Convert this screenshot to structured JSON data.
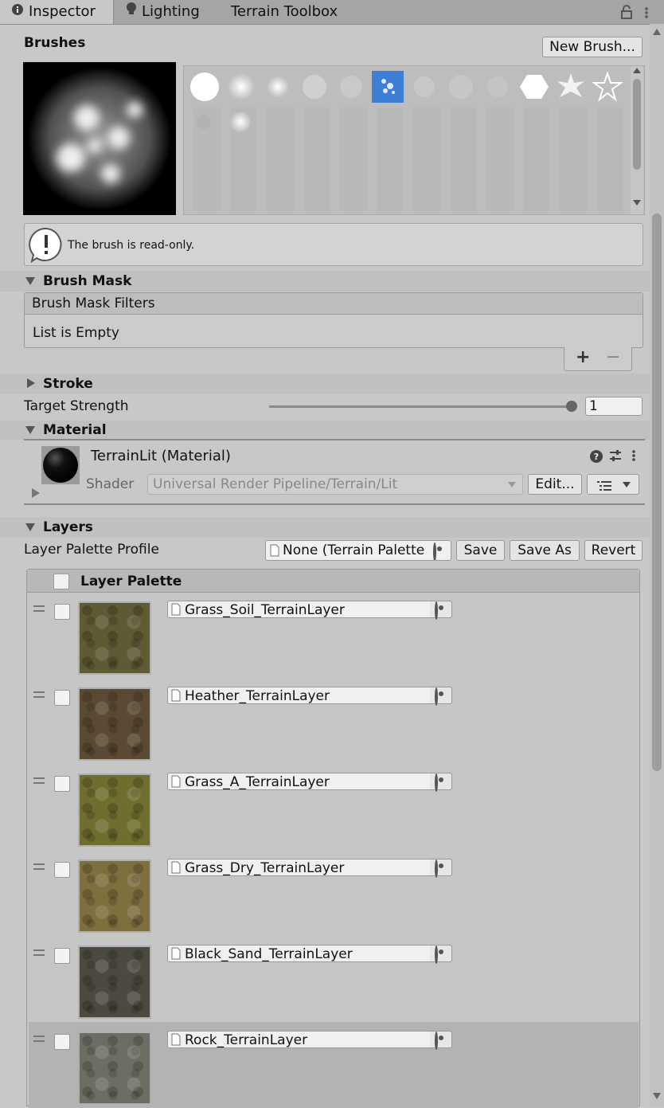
{
  "tabs": [
    {
      "label": "Inspector"
    },
    {
      "label": "Lighting"
    },
    {
      "label": "Terrain Toolbox"
    }
  ],
  "brushes": {
    "title": "Brushes",
    "new_button": "New Brush...",
    "readonly_message": "The brush is read-only."
  },
  "brush_mask": {
    "title": "Brush Mask",
    "list_header": "Brush Mask Filters",
    "empty_text": "List is Empty",
    "add_label": "+",
    "remove_label": "−"
  },
  "stroke": {
    "title": "Stroke"
  },
  "target_strength": {
    "label": "Target Strength",
    "value": "1",
    "slider_fraction": 1.0
  },
  "material": {
    "title": "Material",
    "name": "TerrainLit (Material)",
    "shader_label": "Shader",
    "shader_value": "Universal Render Pipeline/Terrain/Lit",
    "edit_button": "Edit..."
  },
  "layers": {
    "title": "Layers",
    "profile_label": "Layer Palette Profile",
    "profile_value": "None (Terrain Palette",
    "save_button": "Save",
    "save_as_button": "Save As",
    "revert_button": "Revert",
    "palette_header": "Layer Palette",
    "items": [
      {
        "name": "Grass_Soil_TerrainLayer",
        "color": "#5e5a34"
      },
      {
        "name": "Heather_TerrainLayer",
        "color": "#5b4a33"
      },
      {
        "name": "Grass_A_TerrainLayer",
        "color": "#6f6e2f"
      },
      {
        "name": "Grass_Dry_TerrainLayer",
        "color": "#7d6f3e"
      },
      {
        "name": "Black_Sand_TerrainLayer",
        "color": "#4c4a40"
      },
      {
        "name": "Rock_TerrainLayer",
        "color": "#6d6e63"
      }
    ]
  }
}
